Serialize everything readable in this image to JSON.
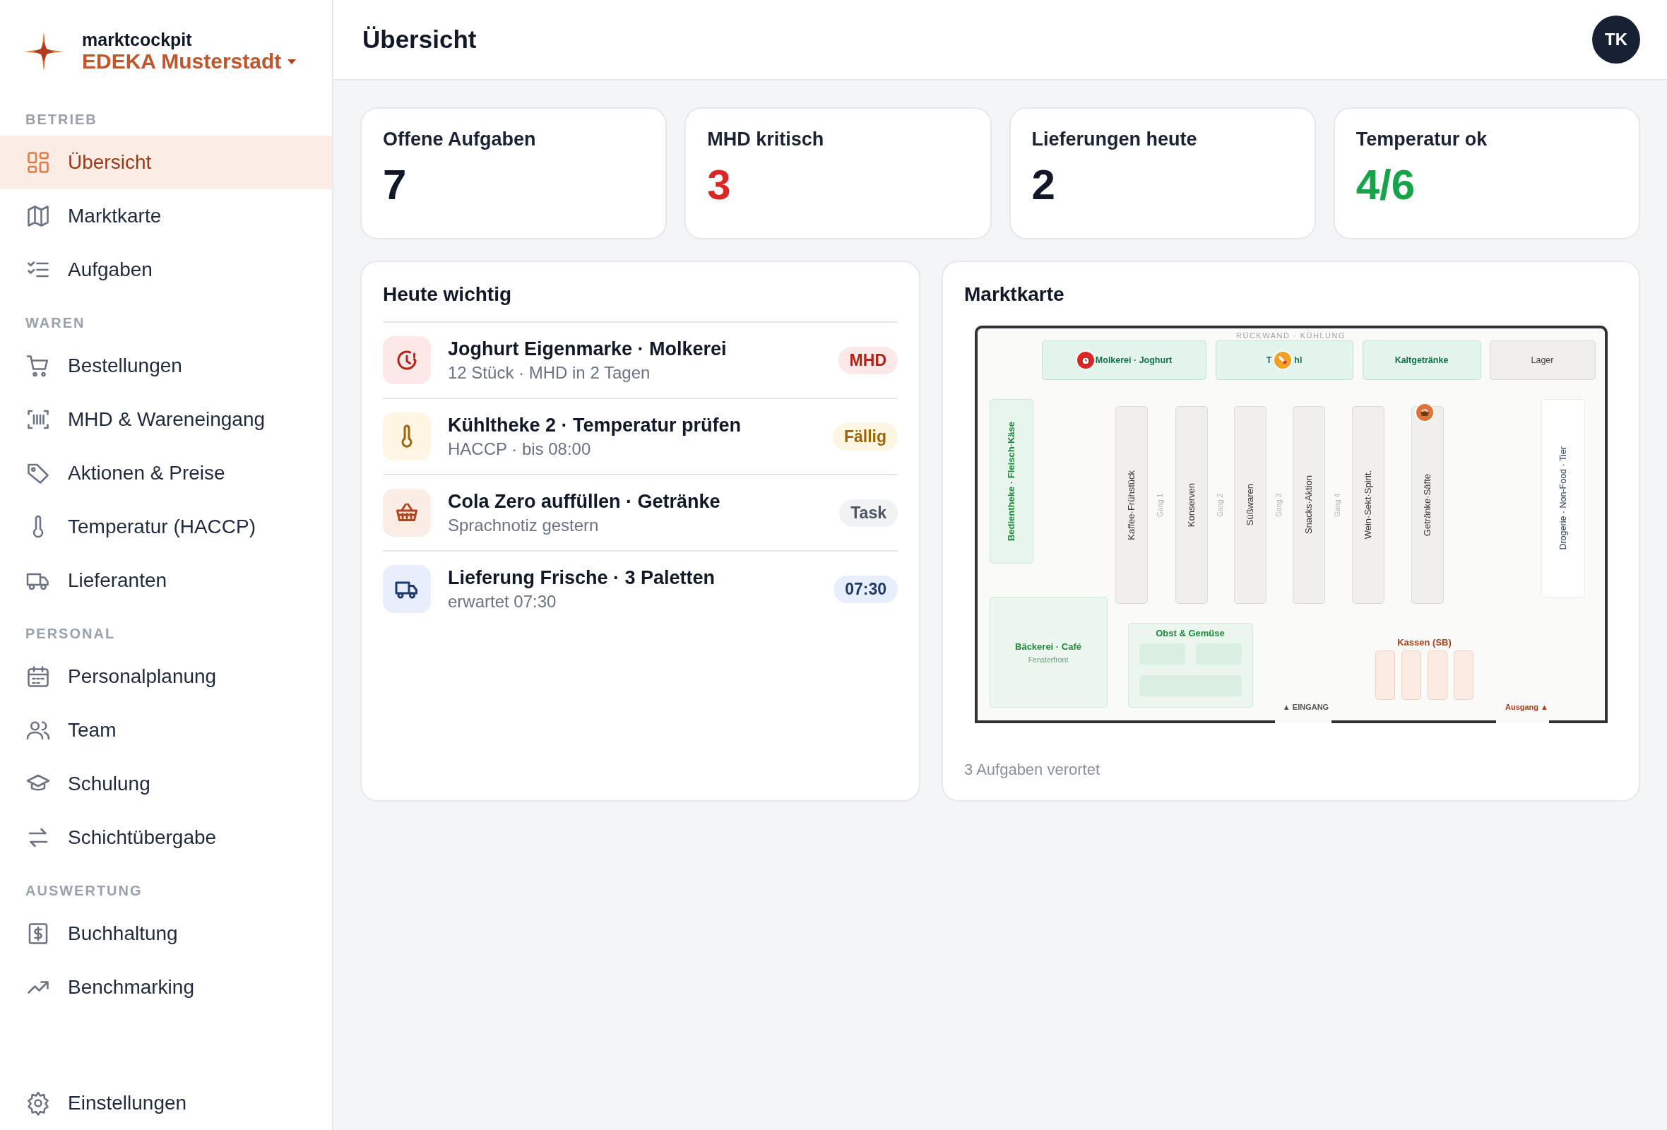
{
  "brand": {
    "product": "marktcockpit",
    "store": "EDEKA Musterstadt"
  },
  "sidebar": {
    "sections": [
      {
        "title": "BETRIEB",
        "items": [
          {
            "label": "Übersicht",
            "selected": true
          },
          {
            "label": "Marktkarte",
            "selected": false
          },
          {
            "label": "Aufgaben",
            "selected": false
          }
        ]
      },
      {
        "title": "WAREN",
        "items": [
          {
            "label": "Bestellungen",
            "selected": false
          },
          {
            "label": "MHD & Wareneingang",
            "selected": false
          },
          {
            "label": "Aktionen & Preise",
            "selected": false
          },
          {
            "label": "Temperatur (HACCP)",
            "selected": false
          },
          {
            "label": "Lieferanten",
            "selected": false
          }
        ]
      },
      {
        "title": "PERSONAL",
        "items": [
          {
            "label": "Personalplanung",
            "selected": false
          },
          {
            "label": "Team",
            "selected": false
          },
          {
            "label": "Schulung",
            "selected": false
          },
          {
            "label": "Schichtübergabe",
            "selected": false
          }
        ]
      },
      {
        "title": "AUSWERTUNG",
        "items": [
          {
            "label": "Buchhaltung",
            "selected": false
          },
          {
            "label": "Benchmarking",
            "selected": false
          }
        ]
      }
    ],
    "footer_item": {
      "label": "Einstellungen",
      "selected": false
    }
  },
  "header": {
    "title": "Übersicht",
    "avatar": "TK"
  },
  "stats": [
    {
      "title": "Offene Aufgaben",
      "value": "7",
      "kind": "neutral"
    },
    {
      "title": "MHD kritisch",
      "value": "3",
      "kind": "danger"
    },
    {
      "title": "Lieferungen heute",
      "value": "2",
      "kind": "neutral"
    },
    {
      "title": "Temperatur ok",
      "value": "4/6",
      "kind": "success"
    }
  ],
  "today": {
    "title": "Heute wichtig",
    "items": [
      {
        "kind": "mhd",
        "title": "Joghurt Eigenmarke · Molkerei",
        "subtitle": "12 Stück · MHD in 2 Tagen",
        "badge": "MHD"
      },
      {
        "kind": "temperature",
        "title": "Kühltheke 2 · Temperatur prüfen",
        "subtitle": "HACCP · bis 08:00",
        "badge": "Fällig"
      },
      {
        "kind": "task",
        "title": "Cola Zero auffüllen · Getränke",
        "subtitle": "Sprachnotiz gestern",
        "badge": "Task"
      },
      {
        "kind": "delivery",
        "title": "Lieferung Frische · 3 Paletten",
        "subtitle": "erwartet 07:30",
        "badge": "07:30"
      }
    ]
  },
  "map": {
    "title": "Marktkarte",
    "wall_label": "RÜCKWAND · KÜHLUNG",
    "top_zones": [
      {
        "label": "Molkerei · Joghurt",
        "kind": "cool"
      },
      {
        "label": "T",
        "label_after_marker": "hl",
        "kind": "cool"
      },
      {
        "label": "Kaltgetränke",
        "kind": "cool"
      },
      {
        "label": "Lager",
        "kind": "storage"
      }
    ],
    "service_counter": "Bedientheke · Fleisch·Käse",
    "shelves": [
      {
        "label": "Kaffee·Frühstück"
      },
      {
        "label": "Konserven"
      },
      {
        "label": "Süßwaren"
      },
      {
        "label": "Snacks·Aktion"
      },
      {
        "label": "Wein·Sekt·Spirit."
      },
      {
        "label": "Getränke·Säfte"
      }
    ],
    "aisles": [
      "Gang 1",
      "Gang 2",
      "Gang 3",
      "Gang 4"
    ],
    "side_zone": "Drogerie · Non-Food · Tier",
    "bakery": {
      "label": "Bäckerei · Café",
      "sublabel": "Fensterfront"
    },
    "produce": "Obst & Gemüse",
    "checkout": "Kassen (SB)",
    "entrance": "▲ EINGANG",
    "exit": "Ausgang ▲",
    "footer": "3 Aufgaben verortet"
  }
}
